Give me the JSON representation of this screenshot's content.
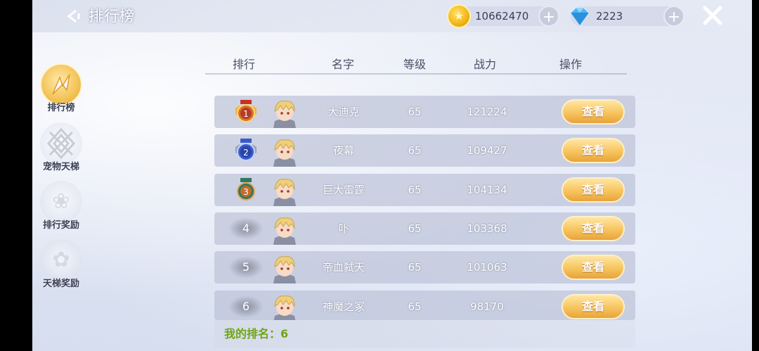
{
  "header": {
    "title": "排行榜",
    "gold": "10662470",
    "gems": "2223"
  },
  "sidebar": {
    "items": [
      {
        "label": "排行榜",
        "active": true,
        "icon": "ranking-icon"
      },
      {
        "label": "宠物天梯",
        "active": false,
        "icon": "pet-ladder-icon"
      },
      {
        "label": "排行奖励",
        "active": false,
        "icon": "flower-icon"
      },
      {
        "label": "天梯奖励",
        "active": false,
        "icon": "flower-icon"
      }
    ]
  },
  "table": {
    "headers": [
      "排行",
      "名字",
      "等级",
      "战力",
      "操作"
    ],
    "view_label": "查看",
    "rows": [
      {
        "rank": "1",
        "name": "大迪克",
        "level": "65",
        "power": "121224"
      },
      {
        "rank": "2",
        "name": "夜幕",
        "level": "65",
        "power": "109427"
      },
      {
        "rank": "3",
        "name": "巨大雷霆",
        "level": "65",
        "power": "104134"
      },
      {
        "rank": "4",
        "name": "卟",
        "level": "65",
        "power": "103368"
      },
      {
        "rank": "5",
        "name": "帝血弑天",
        "level": "65",
        "power": "101063"
      },
      {
        "rank": "6",
        "name": "神魔之冢",
        "level": "65",
        "power": "98170"
      }
    ]
  },
  "footer": {
    "my_rank": "我的排名：6"
  },
  "colors": {
    "gold_medal": "#d0752a",
    "silver_medal": "#3a5bc9",
    "bronze_medal": "#2f7a5e",
    "button": "#f7c45e",
    "my_rank_text": "#6ea614"
  }
}
